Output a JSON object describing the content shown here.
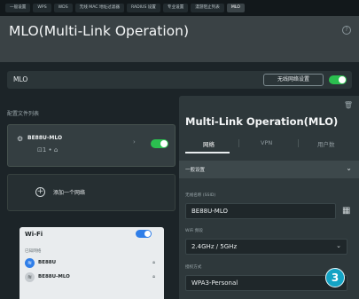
{
  "tabs": [
    "一般设置",
    "WPS",
    "WDS",
    "无线 MAC 地址过滤器",
    "RADIUS 设置",
    "专业设置",
    "漫游阻止列表",
    "MLO"
  ],
  "header": {
    "title": "MLO(Multi-Link Operation)",
    "help": "?"
  },
  "mlo_bar": {
    "label": "MLO",
    "wifi_settings_btn": "无线网络设置",
    "enabled": true
  },
  "profiles": {
    "heading": "配置文件列表",
    "items": [
      {
        "name": "BE88U-MLO",
        "sub": "⊡1 • ⌂"
      }
    ],
    "add_label": "添加一个网络"
  },
  "wifi_popup": {
    "title": "Wi-Fi",
    "known_label": "已知网络",
    "networks": [
      {
        "ssid": "BE88U"
      },
      {
        "ssid": "BE88U-MLO"
      }
    ]
  },
  "detail": {
    "title": "Multi-Link Operation(MLO)",
    "tabs": [
      "网络",
      "VPN",
      "用户数"
    ],
    "general_label": "一般设置",
    "ssid_label": "无线名称 (SSID)",
    "ssid_value": "BE88U-MLO",
    "band_label": "WiFi 频段",
    "band_value": "2.4GHz / 5GHz",
    "auth_label": "授权方式",
    "auth_value": "WPA3-Personal"
  },
  "badge": "3",
  "colors": {
    "toggle_on": "#2bbf4f",
    "wifi_toggle": "#2f7ee8",
    "badge": "#14a3c4"
  }
}
